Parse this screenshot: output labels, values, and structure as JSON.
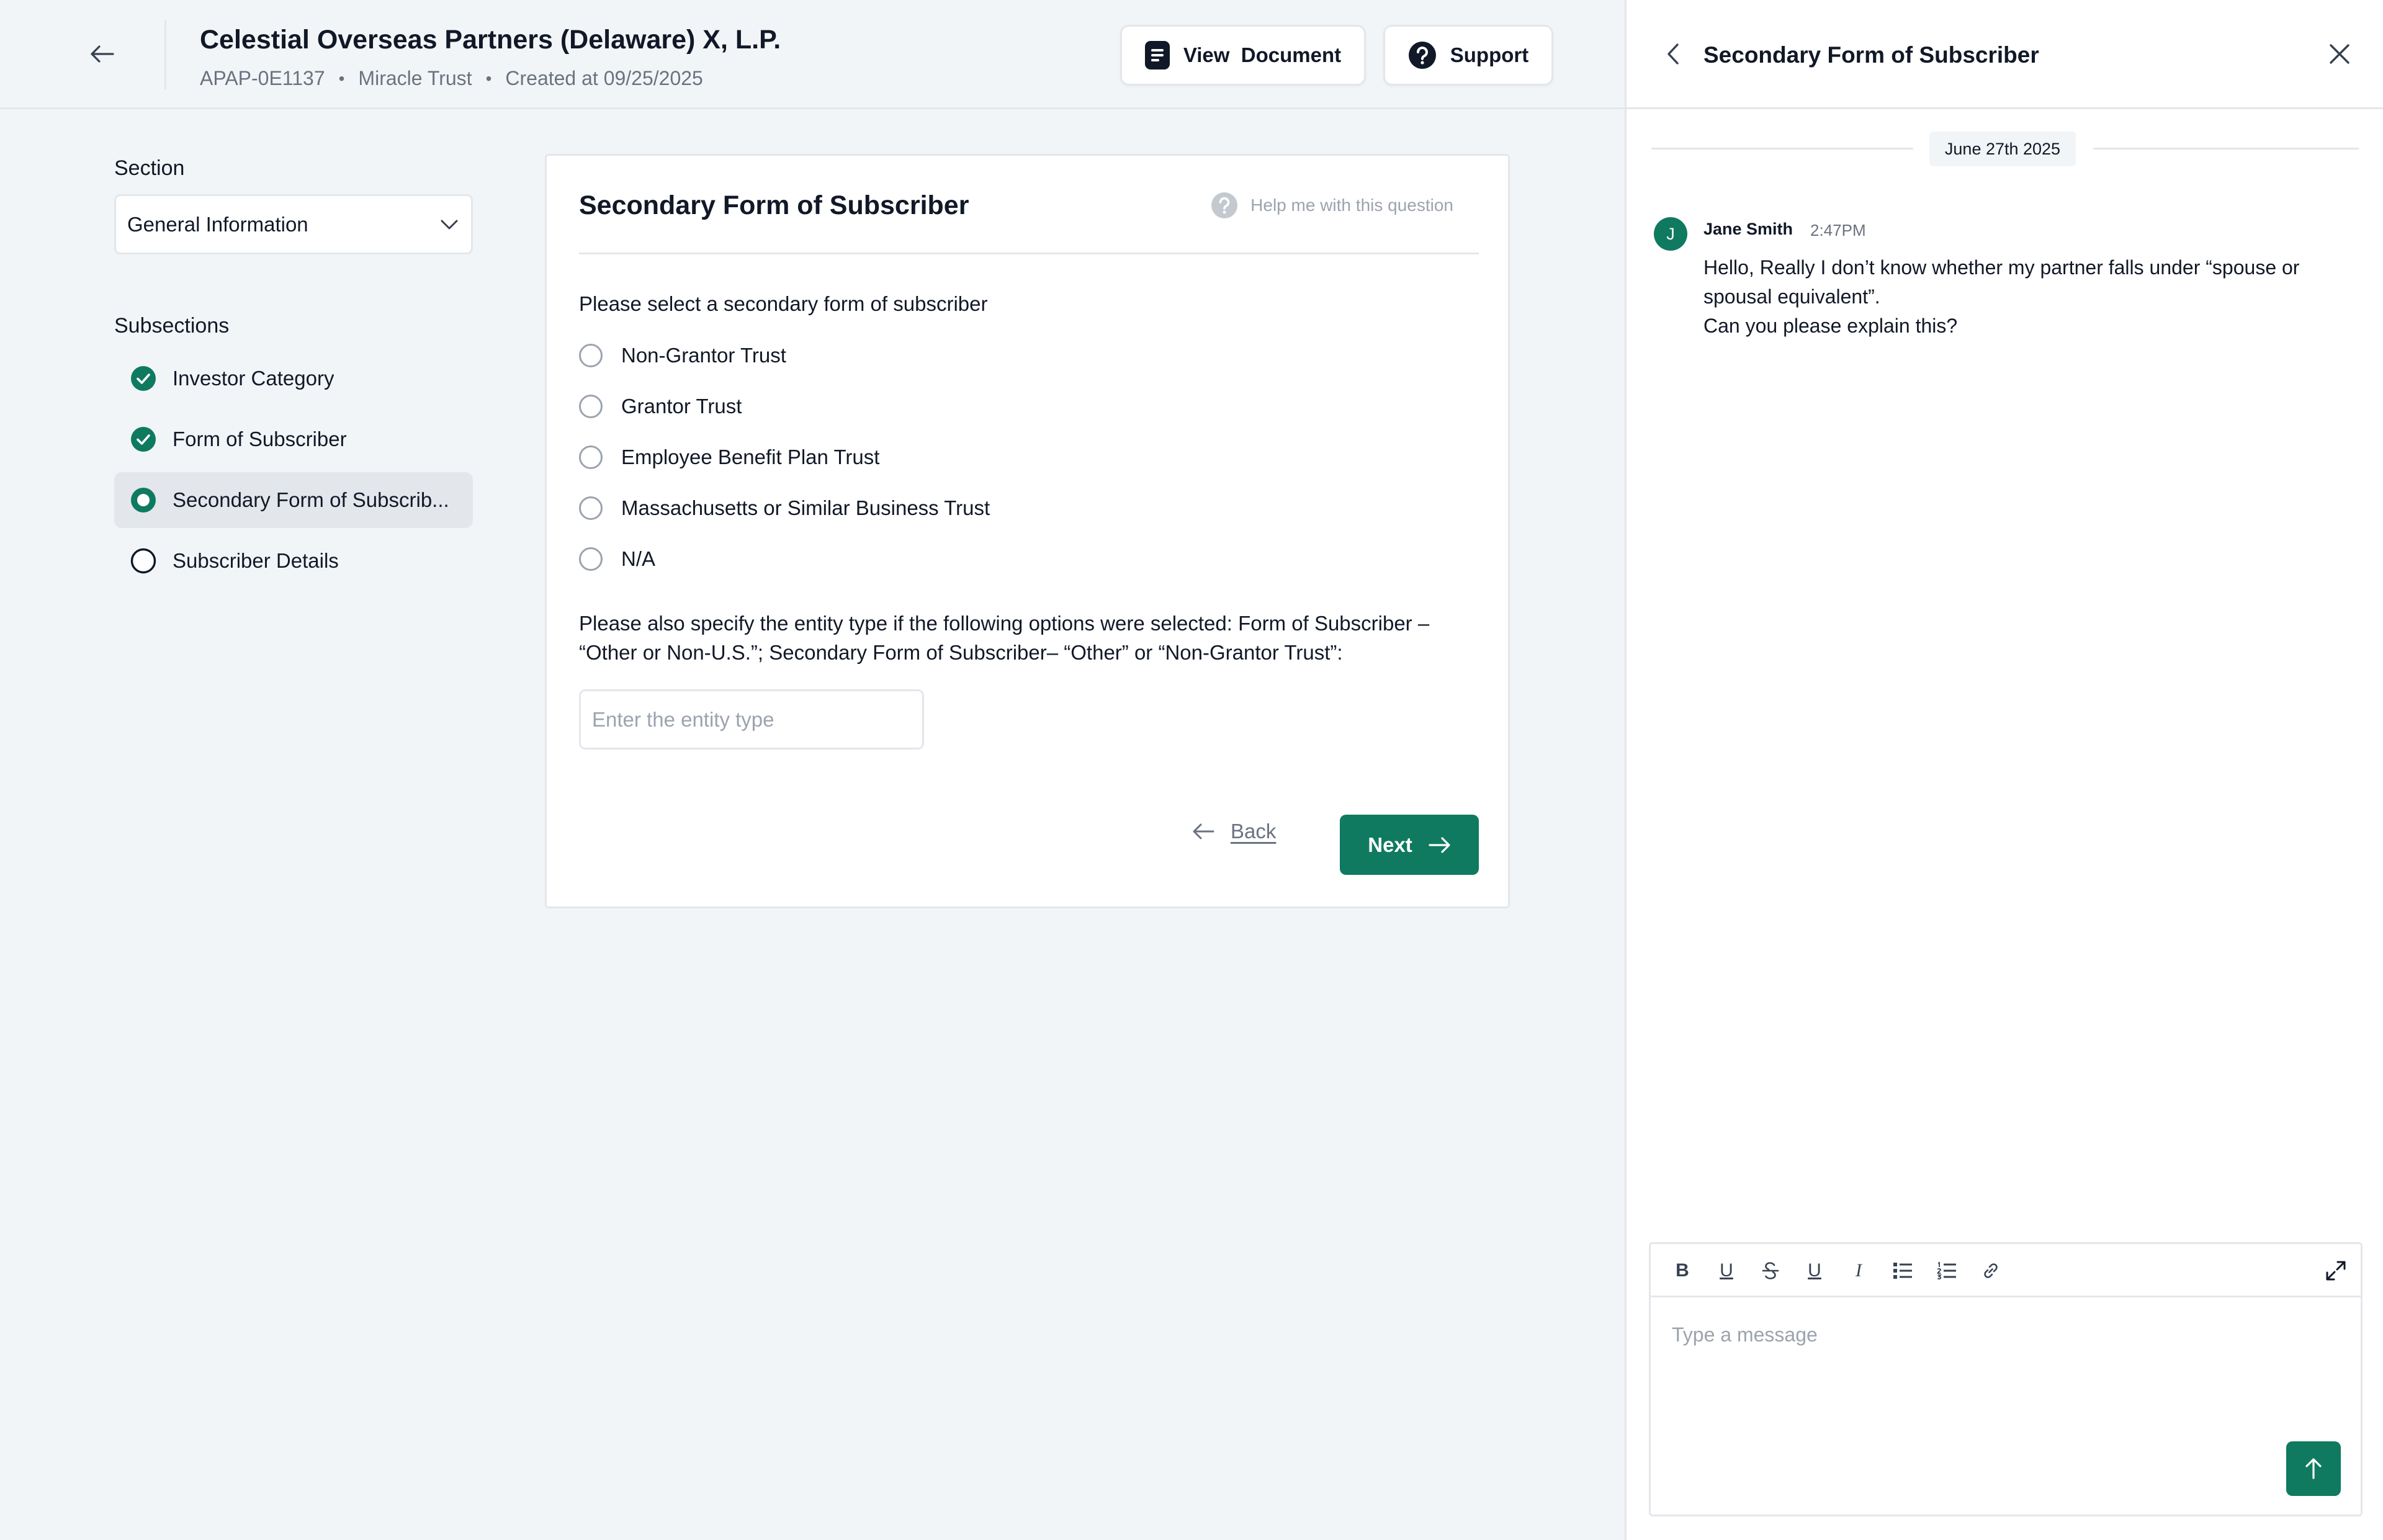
{
  "header": {
    "title": "Celestial Overseas Partners (Delaware) X, L.P.",
    "meta": [
      "APAP-0E1137",
      "Miracle Trust",
      "Created at 09/25/2025"
    ],
    "view_document_label": "View  Document",
    "support_label": "Support"
  },
  "sidebar": {
    "section_label": "Section",
    "section_value": "General Information",
    "subsections_label": "Subsections",
    "items": [
      {
        "label": "Investor Category",
        "status": "complete"
      },
      {
        "label": "Form of Subscriber",
        "status": "complete"
      },
      {
        "label": "Secondary Form of Subscrib...",
        "status": "current"
      },
      {
        "label": "Subscriber Details",
        "status": "todo"
      }
    ]
  },
  "form": {
    "title": "Secondary Form of Subscriber",
    "help_label": "Help me with this question",
    "question": "Please select a secondary form of subscriber",
    "options": [
      "Non-Grantor Trust",
      "Grantor Trust",
      "Employee Benefit Plan Trust",
      "Massachusetts or Similar Business Trust",
      "N/A"
    ],
    "entity_note": "Please also specify the entity type if the following options were selected: Form of Subscriber – “Other or Non-U.S.”; Secondary Form of Subscriber– “Other” or “Non-Grantor Trust”:",
    "entity_placeholder": "Enter the entity type",
    "entity_value": "",
    "back_label": "Back",
    "next_label": "Next"
  },
  "chat": {
    "title": "Secondary Form of Subscriber",
    "date": "June 27th 2025",
    "messages": [
      {
        "avatar_initial": "J",
        "author": "Jane Smith",
        "time": "2:47PM",
        "lines": [
          "Hello, Really I don’t know whether my partner falls under “spouse or",
          "spousal equivalent”.",
          "Can you please explain this?"
        ]
      }
    ],
    "input_placeholder": "Type a message",
    "input_value": "",
    "toolbar": {
      "bold": "B",
      "underline": "U",
      "underline2": "U",
      "italic": "I"
    }
  },
  "colors": {
    "accent": "#0f7a5f",
    "border": "#e3e7eb",
    "muted_text": "#6b7280",
    "background": "#f2f5f7"
  },
  "icons": {
    "back": "arrow-left-icon",
    "view_document": "document-icon",
    "support": "question-circle-icon",
    "select": "chevron-down-icon",
    "complete": "check-circle-icon",
    "current": "radio-dot-icon",
    "todo": "empty-circle-icon",
    "help": "question-circle-icon",
    "next": "arrow-right-icon",
    "close": "close-icon",
    "send": "arrow-up-icon",
    "expand": "expand-icon"
  }
}
